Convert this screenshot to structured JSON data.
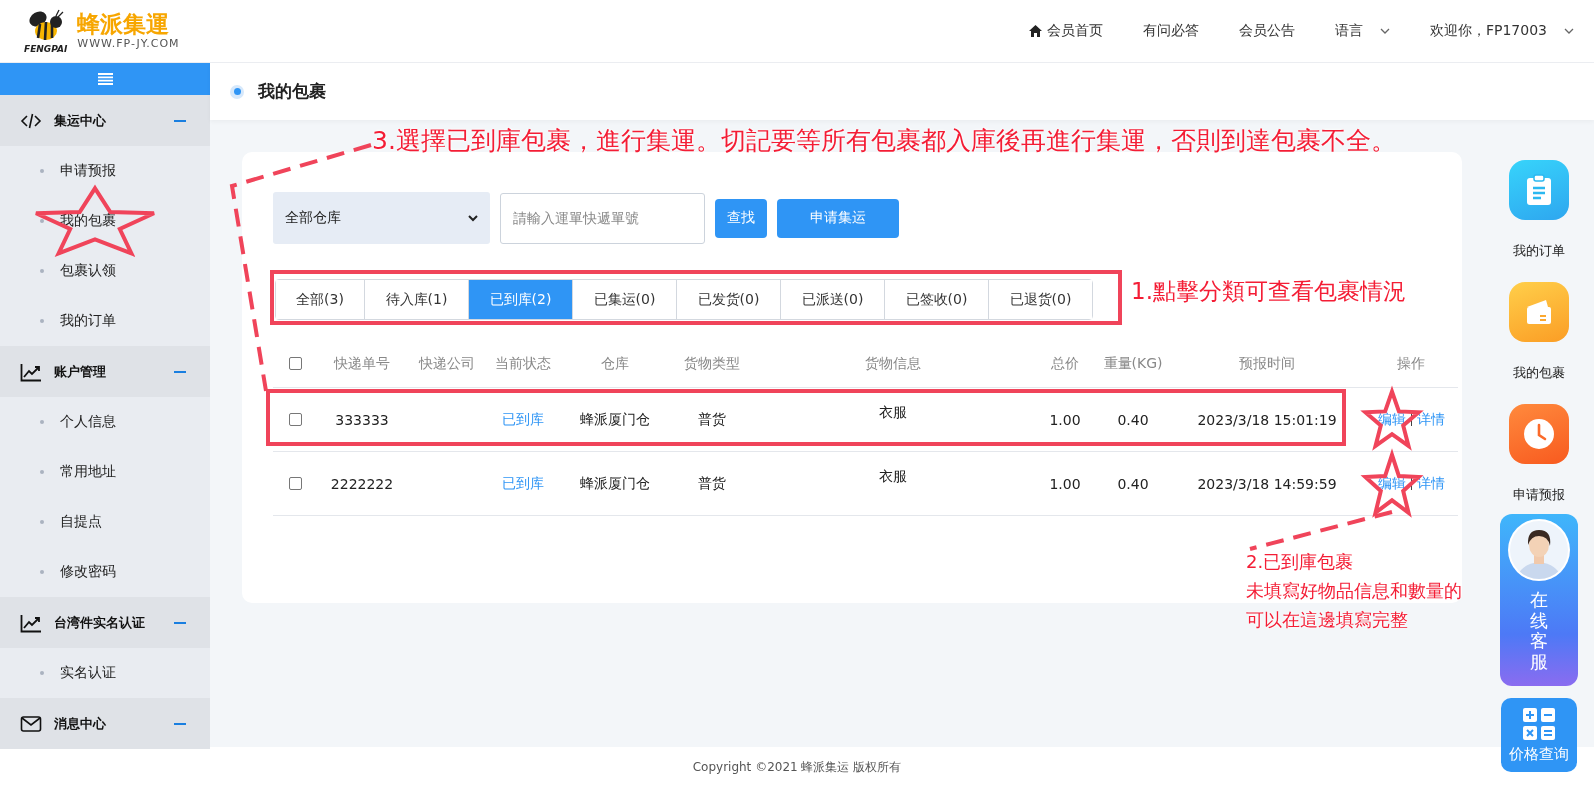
{
  "header": {
    "brand": "蜂派集運",
    "brand_sub": "FENGPAI",
    "site": "WWW.FP-JY.COM",
    "nav": [
      {
        "label": "会员首页",
        "kind": "home"
      },
      {
        "label": "有问必答",
        "kind": "plain"
      },
      {
        "label": "会员公告",
        "kind": "plain"
      },
      {
        "label": "语言",
        "kind": "dropdown"
      },
      {
        "label": "欢迎你，FP17003",
        "kind": "dropdown"
      }
    ]
  },
  "sidebar": {
    "groups": [
      {
        "title": "集运中心",
        "kind": "code",
        "expanded": true,
        "items": [
          "申请预报",
          "我的包裹",
          "包裹认领",
          "我的订单"
        ]
      },
      {
        "title": "账户管理",
        "kind": "chart",
        "expanded": true,
        "items": [
          "个人信息",
          "常用地址",
          "自提点",
          "修改密码"
        ]
      },
      {
        "title": "台湾件实名认证",
        "kind": "chart",
        "expanded": true,
        "items": [
          "实名认证"
        ]
      },
      {
        "title": "消息中心",
        "kind": "mail",
        "expanded": true
      }
    ]
  },
  "page_title": "我的包裹",
  "filters": {
    "warehouse": "全部仓库",
    "search": {
      "placeholder": "請輸入運單快遞單號"
    },
    "buttons": [
      "查找",
      "申请集运"
    ]
  },
  "tabs": [
    {
      "label": "全部(3)",
      "selected": false
    },
    {
      "label": "待入库(1)",
      "selected": false
    },
    {
      "label": "已到库(2)",
      "selected": true
    },
    {
      "label": "已集运(0)",
      "selected": false
    },
    {
      "label": "已发货(0)",
      "selected": false
    },
    {
      "label": "已派送(0)",
      "selected": false
    },
    {
      "label": "已签收(0)",
      "selected": false
    },
    {
      "label": "已退货(0)",
      "selected": false
    }
  ],
  "table": {
    "select_all": {
      "checked": false
    },
    "columns": [
      "快递单号",
      "快递公司",
      "当前状态",
      "仓库",
      "货物类型",
      "货物信息",
      "总价",
      "重量(KG)",
      "预报时间",
      "操作"
    ],
    "rows": [
      {
        "checked": false,
        "cells": [
          "333333",
          "",
          "已到库",
          "蜂派厦门仓",
          "普货",
          "衣服",
          "1.00",
          "0.40",
          "2023/3/18 15:01:19"
        ],
        "actions": [
          "编辑",
          "详情"
        ]
      },
      {
        "checked": false,
        "cells": [
          "2222222",
          "",
          "已到库",
          "蜂派厦门仓",
          "普货",
          "衣服",
          "1.00",
          "0.40",
          "2023/3/18 14:59:59"
        ],
        "actions": [
          "编辑",
          "详情"
        ]
      }
    ]
  },
  "rail": [
    {
      "label": "我的订单",
      "kind": "orders"
    },
    {
      "label": "我的包裹",
      "kind": "parcel"
    },
    {
      "label": "申请预报",
      "kind": "clock"
    },
    {
      "label": "在线客服",
      "kind": "service"
    },
    {
      "label": "价格查询",
      "kind": "calc"
    }
  ],
  "footer": {
    "copyright": "Copyright ©2021",
    "brand": "蜂派集运",
    "rights": "版权所有"
  },
  "annotations": {
    "note_1": "1.點擊分類可查看包裹情況",
    "note_2": [
      "2.已到庫包裹",
      "未填寫好物品信息和數量的",
      "可以在這邊填寫完整"
    ],
    "note_3": "3.選擇已到庫包裹，進行集運。切記要等所有包裹都入庫後再進行集運，否則到達包裹不全。"
  }
}
